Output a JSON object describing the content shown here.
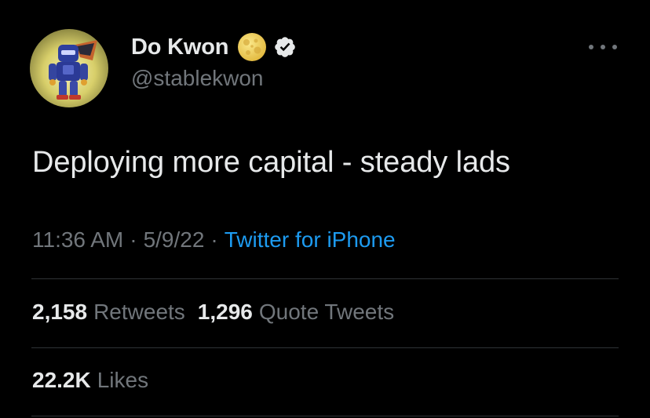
{
  "author": {
    "display_name": "Do Kwon",
    "handle": "@stablekwon",
    "avatar_icon": "robot-avatar",
    "badge_icons": [
      "full-moon-emoji",
      "verified-badge-icon"
    ]
  },
  "menu": {
    "icon": "more-horizontal-icon"
  },
  "tweet": {
    "text": "Deploying more capital - steady lads",
    "time": "11:36 AM",
    "separator": "·",
    "date": "5/9/22",
    "source": "Twitter for iPhone"
  },
  "stats": {
    "retweets": {
      "value": "2,158",
      "label": "Retweets"
    },
    "quote_tweets": {
      "value": "1,296",
      "label": "Quote Tweets"
    },
    "likes": {
      "value": "22.2K",
      "label": "Likes"
    }
  },
  "colors": {
    "background": "#000000",
    "primary_text": "#e7e9ea",
    "secondary_text": "#71767b",
    "link": "#1d9bf0",
    "divider": "#2f3336",
    "moon": "#f2d35b"
  }
}
